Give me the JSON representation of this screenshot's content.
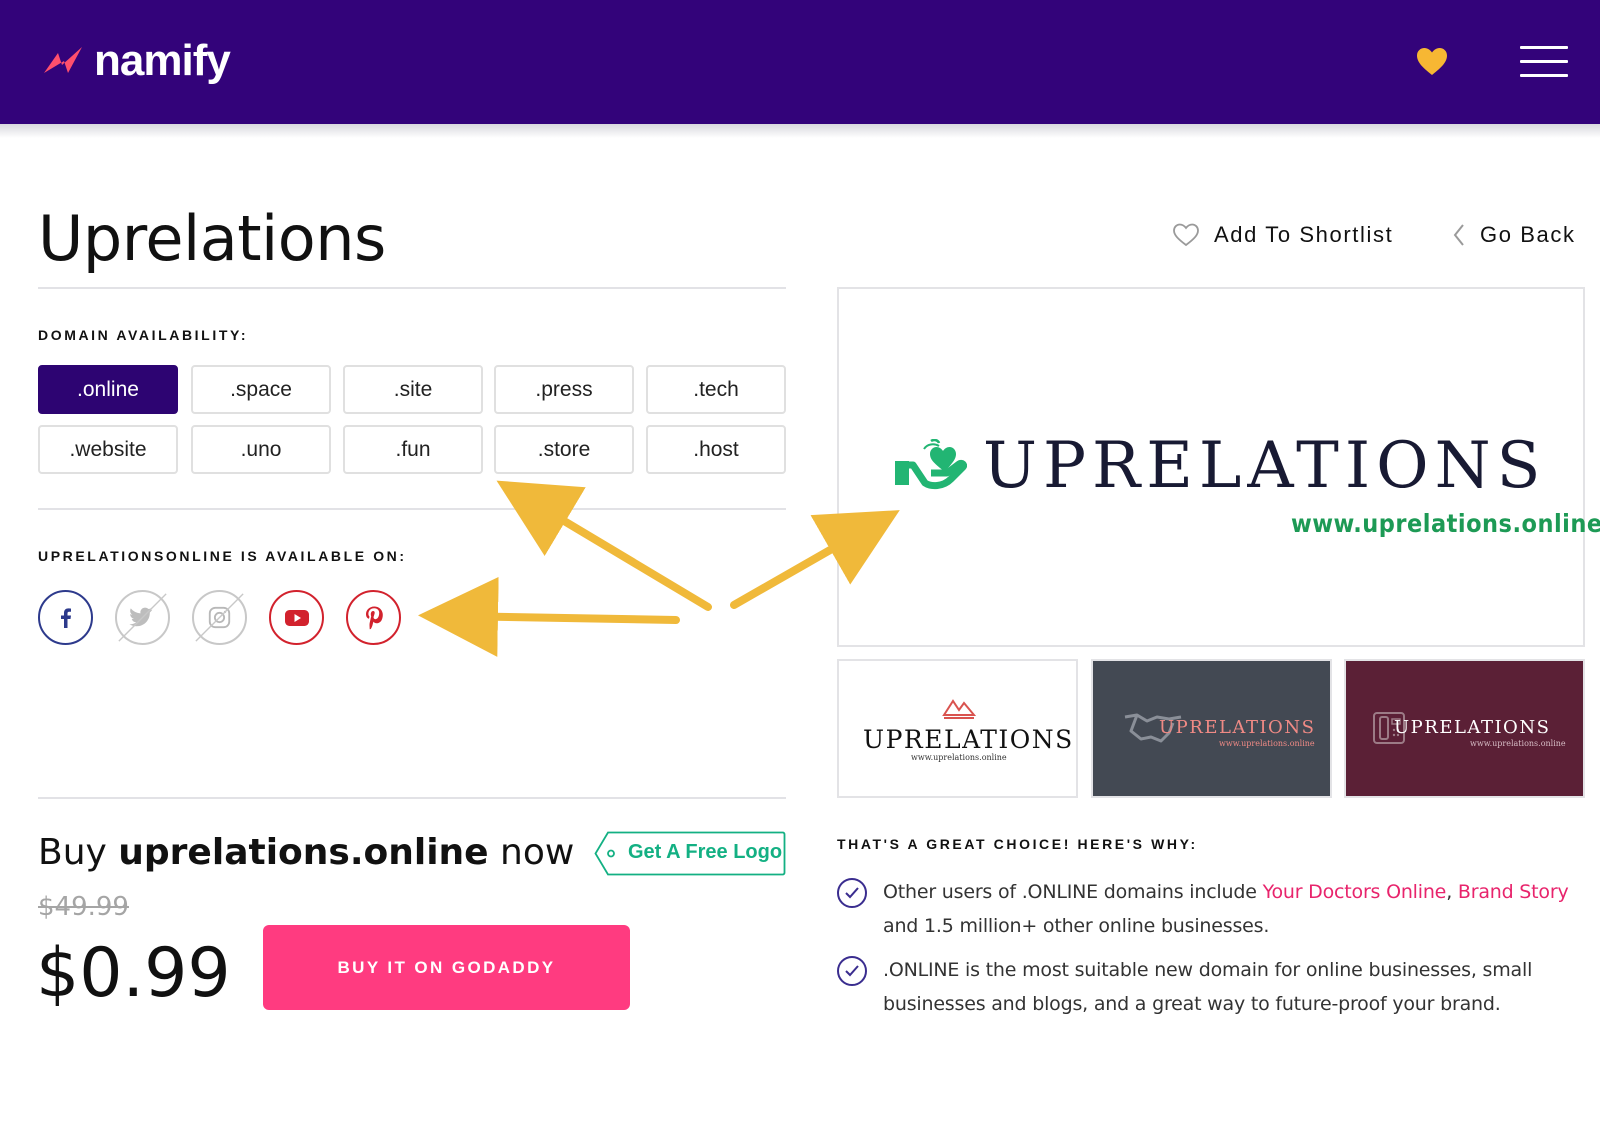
{
  "header": {
    "brand": "namify",
    "shortlist_icon": "heart-icon",
    "menu_icon": "hamburger-menu-icon",
    "colors": {
      "background": "#33037a",
      "heart": "#f7b733",
      "logo_mark": "#ff4f6d"
    }
  },
  "page": {
    "title": "Uprelations",
    "add_to_shortlist": "Add To Shortlist",
    "go_back": "Go Back"
  },
  "domains": {
    "label": "DOMAIN AVAILABILITY:",
    "selected": ".online",
    "tlds": [
      ".online",
      ".space",
      ".site",
      ".press",
      ".tech",
      ".website",
      ".uno",
      ".fun",
      ".store",
      ".host"
    ]
  },
  "socials": {
    "label": "UPRELATIONSONLINE IS AVAILABLE ON:",
    "items": [
      {
        "icon": "facebook-icon",
        "available": true
      },
      {
        "icon": "twitter-icon",
        "available": false
      },
      {
        "icon": "instagram-icon",
        "available": false
      },
      {
        "icon": "youtube-icon",
        "available": true
      },
      {
        "icon": "pinterest-icon",
        "available": true
      }
    ]
  },
  "preview": {
    "wordmark": "UPRELATIONS",
    "url": "www.uprelations.online",
    "thumbnails": [
      {
        "wordmark": "UPRELATIONS",
        "url": "www.uprelations.online",
        "bg": "#ffffff"
      },
      {
        "wordmark": "UPRELATIONS",
        "url": "www.uprelations.online",
        "bg": "#434953"
      },
      {
        "wordmark": "UPRELATIONS",
        "url": "www.uprelations.online",
        "bg": "#5b2036"
      }
    ]
  },
  "buy": {
    "prefix": "Buy",
    "domain": "uprelations.online",
    "suffix": "now",
    "free_logo": "Get A Free Logo",
    "old_price": "$49.99",
    "price": "$0.99",
    "button": "BUY IT ON GODADDY"
  },
  "why": {
    "label": "THAT'S A GREAT CHOICE! HERE'S WHY:",
    "item1": {
      "before": "Other users of .ONLINE domains include ",
      "link1": "Your Doctors Online",
      "sep": ", ",
      "link2": "Brand Story",
      "after": " and 1.5 million+ other online businesses."
    },
    "item2": ".ONLINE is the most suitable new domain for online businesses, small businesses and blogs, and a great way to future-proof your brand."
  }
}
